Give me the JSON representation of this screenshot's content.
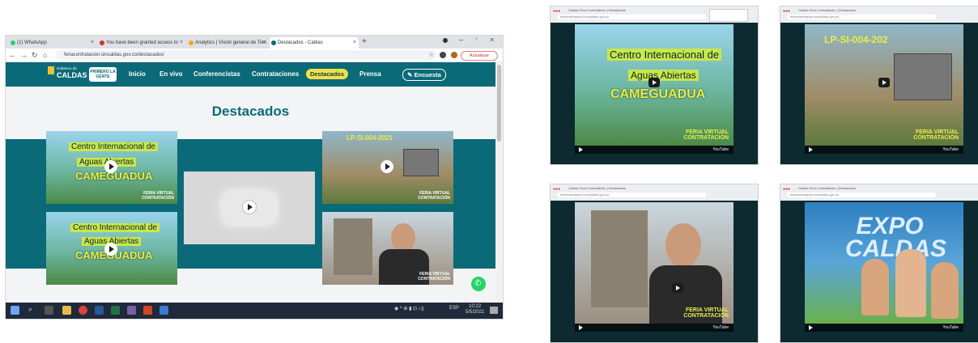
{
  "browser": {
    "tabs": [
      {
        "label": "(1) WhatsApp",
        "color": "#25d366"
      },
      {
        "label": "You have been granted access to",
        "color": "#d93025"
      },
      {
        "label": "Analytics | Visión general de Tien",
        "color": "#f9ab00"
      },
      {
        "label": "Destacados - Caldas",
        "color": "#0b6a77"
      }
    ],
    "new_tab": "+",
    "address": "feriacontratacion.sincaldas.gov.co/destacados/",
    "update_button": "Actualizar"
  },
  "site": {
    "logo_top": "Gobierno de",
    "logo_main": "CALDAS",
    "badge": "PRIMERO LA GENTE",
    "nav": [
      "Inicio",
      "En vivo",
      "Conferencistas",
      "Contrataciones",
      "Destacados",
      "Prensa"
    ],
    "survey_button": "Encuesta",
    "page_heading": "Destacados",
    "cards": {
      "line1": "Centro Internacional de",
      "line2": "Aguas Abiertas",
      "line3": "CAMEGUADUA",
      "feria1": "FERIA VIRTUAL",
      "feria2": "CONTRATACIÓN",
      "process_code": "LP-SI-004-2021"
    }
  },
  "taskbar": {
    "tray_text": "ESP",
    "time": "10:22",
    "date": "5/5/2021"
  },
  "thumbnails": {
    "tabs_text": "Caldas  Feria Contratación | Destacados",
    "address": "feriacontratacion.sincaldas.gov.co",
    "t1_line1": "Centro Internacional de",
    "t1_line2": "Aguas Abiertas",
    "t1_line3": "CAMEGUADUA",
    "t2_code": "LP-SI-004-202",
    "t4_title": "EXPO CALDAS",
    "feria1": "FERIA VIRTUAL",
    "feria2": "CONTRATACIÓN",
    "yt": "YouTube"
  }
}
